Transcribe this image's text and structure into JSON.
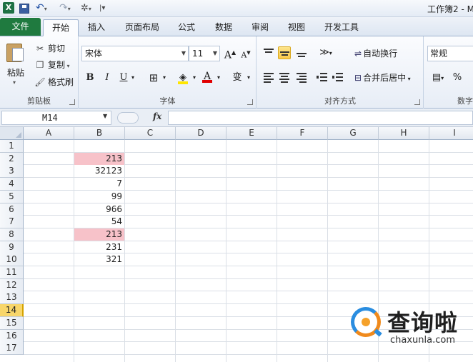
{
  "title_bar": {
    "app_icon_letter": "X",
    "title": "工作簿2 - M"
  },
  "ribbon_tabs": [
    {
      "label": "文件"
    },
    {
      "label": "开始"
    },
    {
      "label": "插入"
    },
    {
      "label": "页面布局"
    },
    {
      "label": "公式"
    },
    {
      "label": "数据"
    },
    {
      "label": "审阅"
    },
    {
      "label": "视图"
    },
    {
      "label": "开发工具"
    }
  ],
  "clipboard": {
    "paste": "粘贴",
    "cut": "剪切",
    "copy": "复制",
    "format_painter": "格式刷",
    "group_label": "剪贴板"
  },
  "font": {
    "name": "宋体",
    "size": "11",
    "bold": "B",
    "italic": "I",
    "underline": "U",
    "grow": "A",
    "shrink": "A",
    "font_color": "A",
    "phonetic": "变",
    "group_label": "字体"
  },
  "alignment": {
    "wrap_text": "自动换行",
    "merge_center": "合并后居中",
    "group_label": "对齐方式"
  },
  "number": {
    "format": "常规",
    "percent": "%",
    "group_label": "数字"
  },
  "formula_bar": {
    "name_box": "M14",
    "fx": "fx",
    "content": ""
  },
  "columns": [
    "A",
    "B",
    "C",
    "D",
    "E",
    "F",
    "G",
    "H",
    "I"
  ],
  "rows": [
    "1",
    "2",
    "3",
    "4",
    "5",
    "6",
    "7",
    "8",
    "9",
    "10",
    "11",
    "12",
    "13",
    "14",
    "15",
    "16",
    "17"
  ],
  "selected_row": "14",
  "cells_b": [
    "",
    "213",
    "32123",
    "7",
    "99",
    "966",
    "54",
    "213",
    "231",
    "321"
  ],
  "highlight_color": "#f7c2c9",
  "watermark": {
    "title": "查询啦",
    "url": "chaxunla.com"
  }
}
